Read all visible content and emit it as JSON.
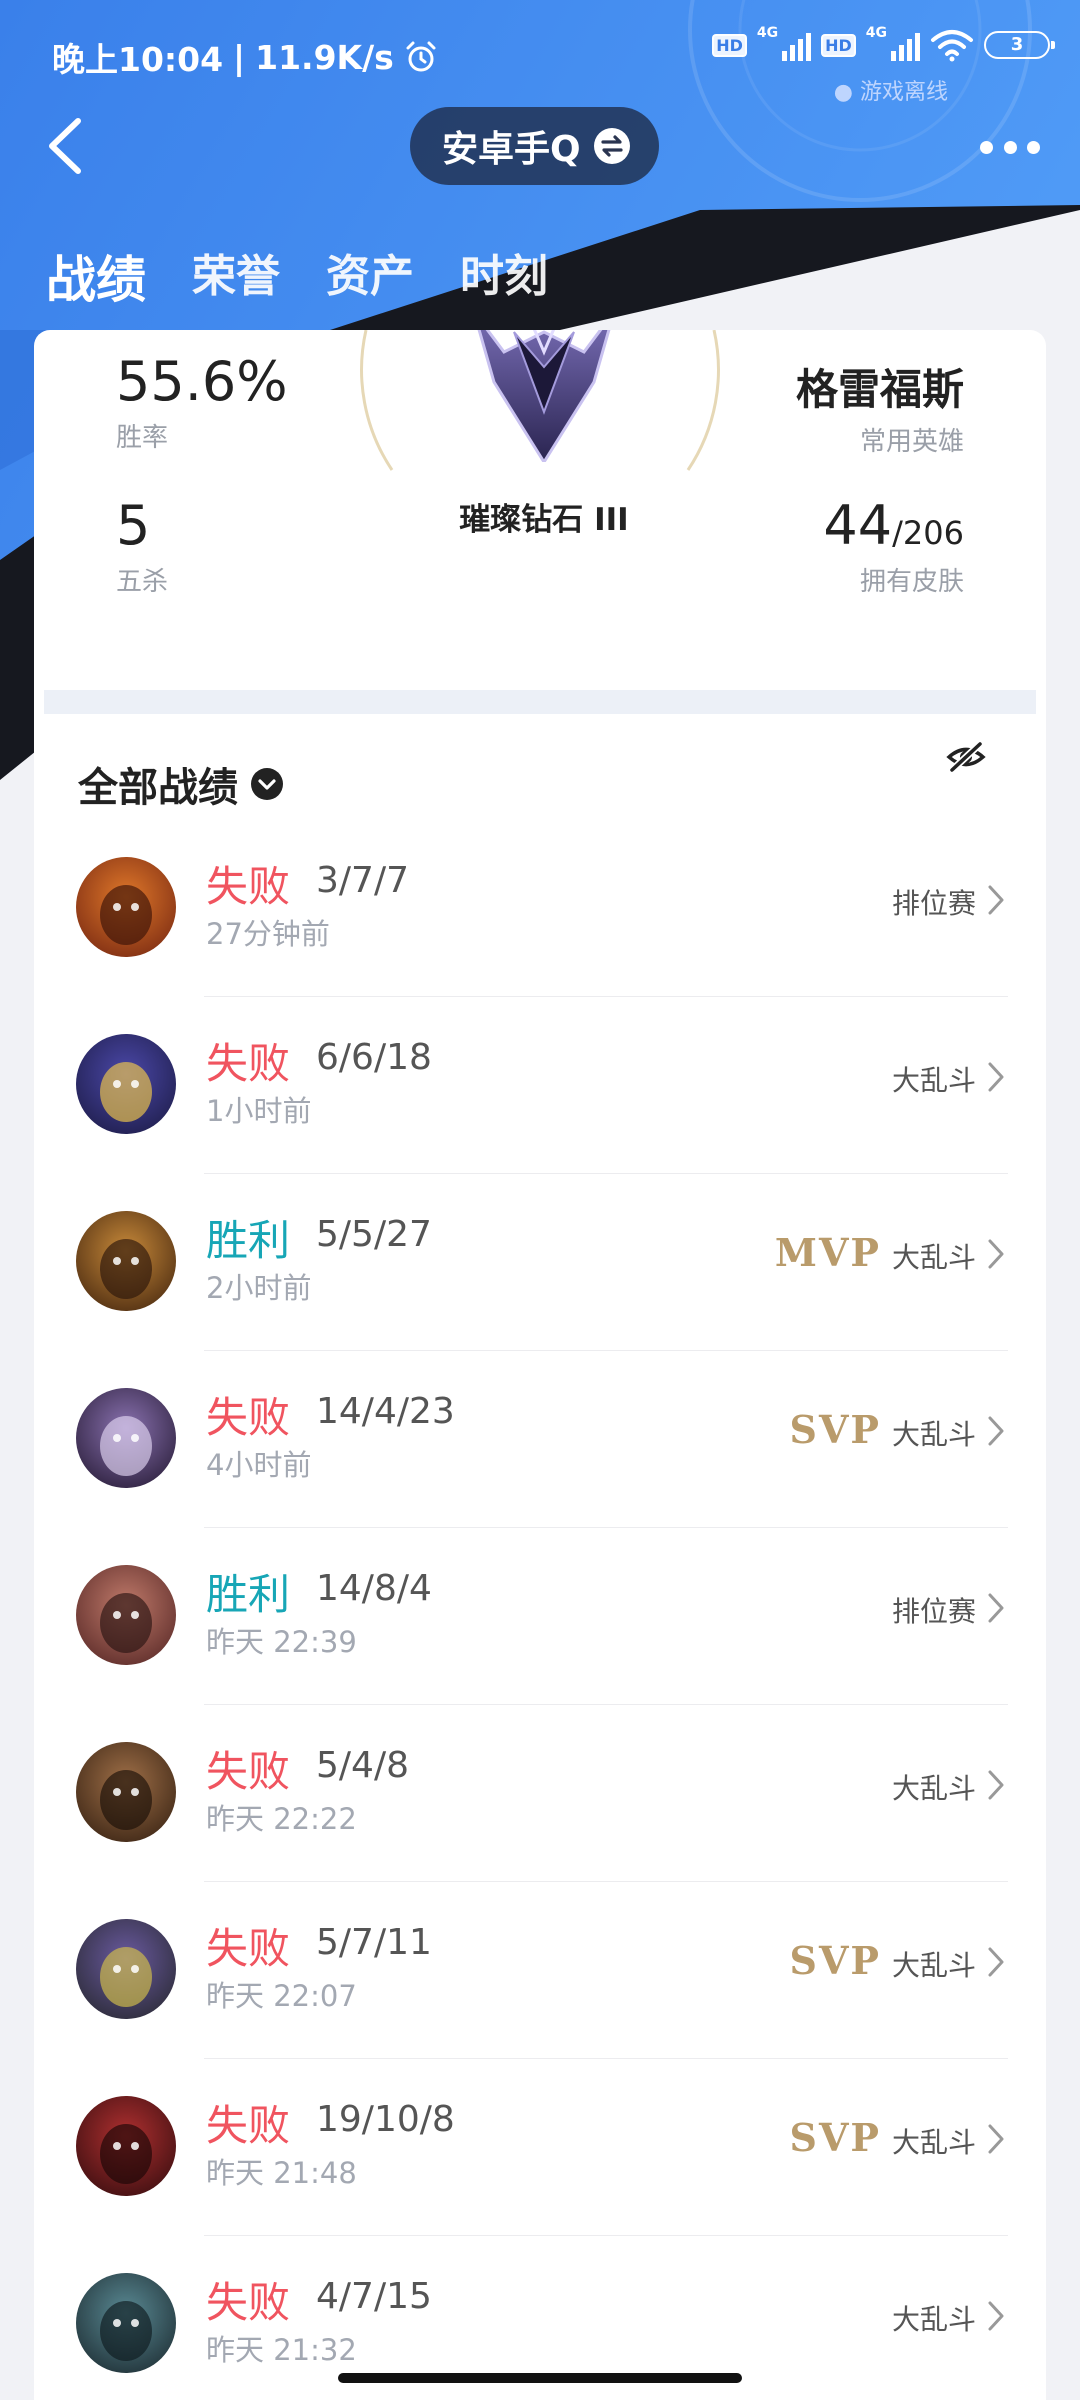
{
  "status_bar": {
    "time": "晚上10:04",
    "speed": "11.9K/s",
    "alarm_icon": "alarm-clock-icon",
    "hd1": "HD",
    "net1": "4G",
    "hd2": "HD",
    "net2": "4G",
    "battery": "3",
    "game_status": "● 游戏离线"
  },
  "titlebar": {
    "back_icon": "chevron-left-icon",
    "title": "安卓手Q",
    "switch_icon": "swap-icon",
    "more_icon": "more-dots-icon"
  },
  "tabs": [
    "战绩",
    "荣誉",
    "资产",
    "时刻"
  ],
  "summary": {
    "win_rate": "55.6%",
    "win_rate_label": "胜率",
    "penta": "5",
    "penta_label": "五杀",
    "rank": "璀璨钻石 III",
    "fav_hero": "格雷福斯",
    "fav_hero_label": "常用英雄",
    "skins_owned": "44",
    "skins_total": "/206",
    "skins_label": "拥有皮肤"
  },
  "section": {
    "title": "全部战绩",
    "dropdown_icon": "dropdown-circle-icon",
    "hide_icon": "eye-off-icon"
  },
  "matches": [
    {
      "result": "失败",
      "kda": "3/7/7",
      "time": "27分钟前",
      "mode": "排位赛",
      "badge": ""
    },
    {
      "result": "失败",
      "kda": "6/6/18",
      "time": "1小时前",
      "mode": "大乱斗",
      "badge": ""
    },
    {
      "result": "胜利",
      "kda": "5/5/27",
      "time": "2小时前",
      "mode": "大乱斗",
      "badge": "MVP"
    },
    {
      "result": "失败",
      "kda": "14/4/23",
      "time": "4小时前",
      "mode": "大乱斗",
      "badge": "SVP"
    },
    {
      "result": "胜利",
      "kda": "14/8/4",
      "time": "昨天 22:39",
      "mode": "排位赛",
      "badge": ""
    },
    {
      "result": "失败",
      "kda": "5/4/8",
      "time": "昨天 22:22",
      "mode": "大乱斗",
      "badge": ""
    },
    {
      "result": "失败",
      "kda": "5/7/11",
      "time": "昨天 22:07",
      "mode": "大乱斗",
      "badge": "SVP"
    },
    {
      "result": "失败",
      "kda": "19/10/8",
      "time": "昨天 21:48",
      "mode": "大乱斗",
      "badge": "SVP"
    },
    {
      "result": "失败",
      "kda": "4/7/15",
      "time": "昨天 21:32",
      "mode": "大乱斗",
      "badge": ""
    }
  ],
  "colors": {
    "lose": "#f0545f",
    "win": "#17a6b6",
    "badge_gold": "#b99b6b",
    "header_blue": "#3b7fe8",
    "header_dark": "#16181f"
  }
}
